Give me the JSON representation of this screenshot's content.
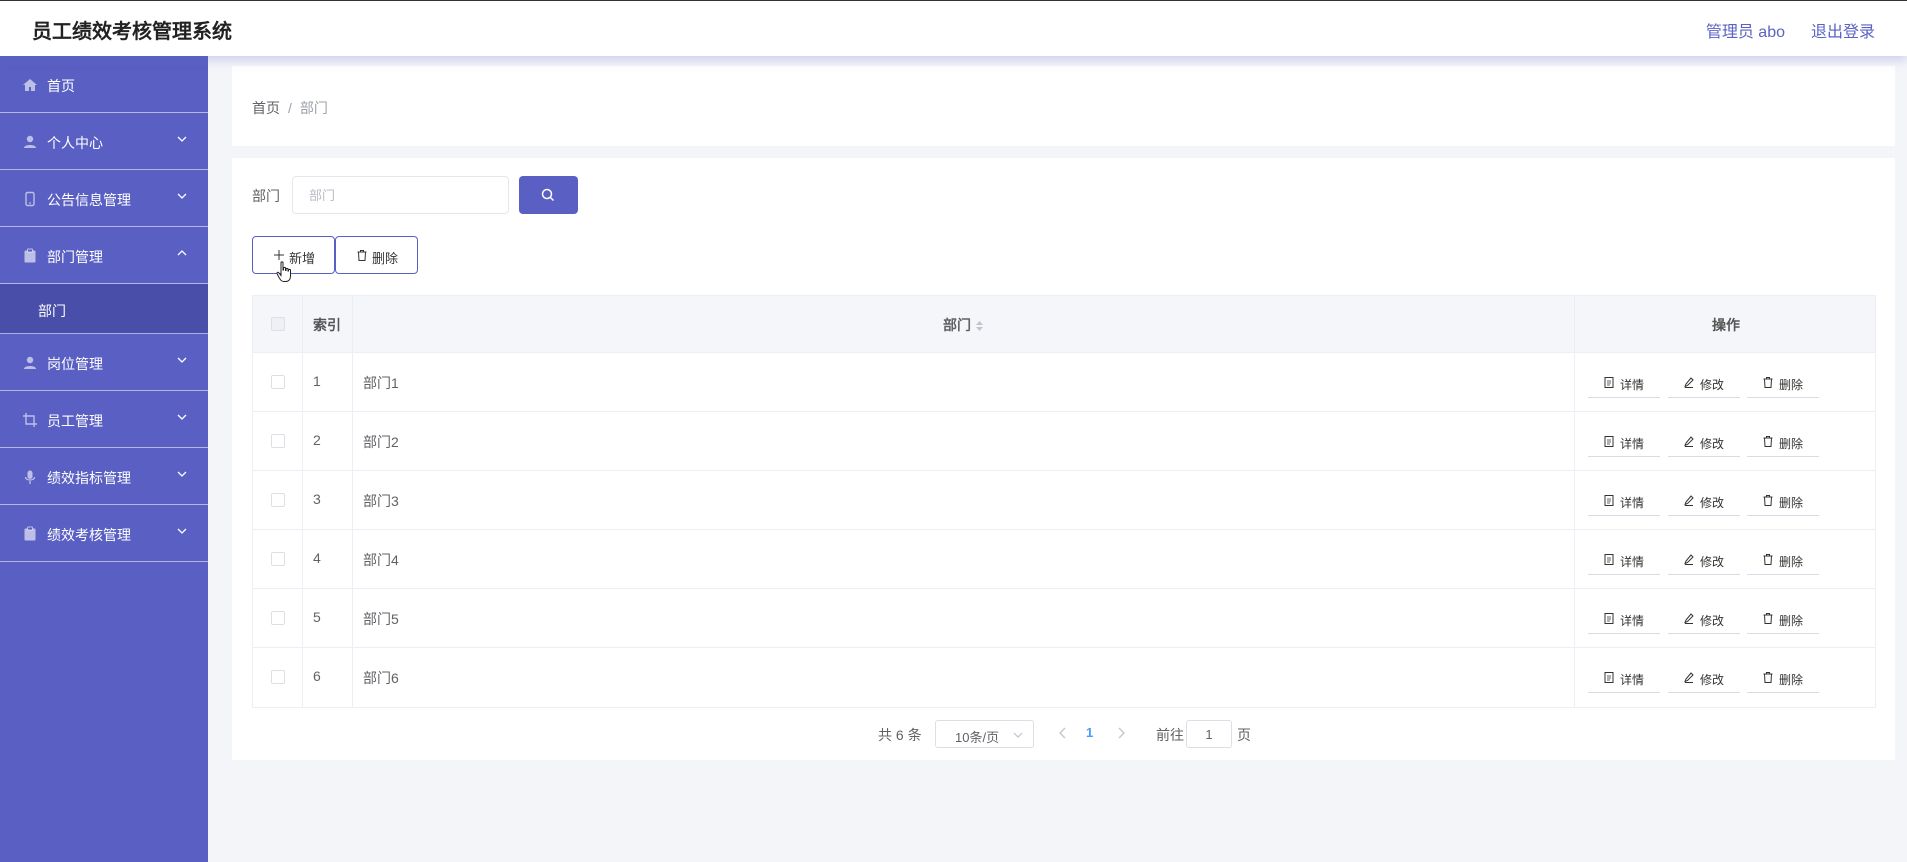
{
  "header": {
    "title": "员工绩效考核管理系统",
    "user": "管理员 abo",
    "logout": "退出登录"
  },
  "sidebar": {
    "items": [
      {
        "label": "首页",
        "icon": "home-icon"
      },
      {
        "label": "个人中心",
        "icon": "user-icon"
      },
      {
        "label": "公告信息管理",
        "icon": "phone-icon"
      },
      {
        "label": "部门管理",
        "icon": "clipboard-icon",
        "expanded": true
      },
      {
        "label": "岗位管理",
        "icon": "user-icon"
      },
      {
        "label": "员工管理",
        "icon": "crop-icon"
      },
      {
        "label": "绩效指标管理",
        "icon": "mic-icon"
      },
      {
        "label": "绩效考核管理",
        "icon": "clipboard-icon"
      }
    ],
    "sub_item": "部门"
  },
  "breadcrumb": {
    "home": "首页",
    "separator": "/",
    "current": "部门"
  },
  "search": {
    "label": "部门",
    "placeholder": "部门"
  },
  "toolbar": {
    "add_label": "新增",
    "delete_label": "删除"
  },
  "table": {
    "headers": {
      "index": "索引",
      "name": "部门",
      "ops": "操作"
    },
    "rows": [
      {
        "index": "1",
        "name": "部门1"
      },
      {
        "index": "2",
        "name": "部门2"
      },
      {
        "index": "3",
        "name": "部门3"
      },
      {
        "index": "4",
        "name": "部门4"
      },
      {
        "index": "5",
        "name": "部门5"
      },
      {
        "index": "6",
        "name": "部门6"
      }
    ],
    "ops": {
      "detail": "详情",
      "edit": "修改",
      "delete": "删除"
    }
  },
  "pagination": {
    "total": "共 6 条",
    "page_size": "10条/页",
    "current_page": "1",
    "goto_label": "前往",
    "goto_value": "1",
    "unit": "页"
  },
  "colors": {
    "accent": "#5a60c3",
    "page_bg": "#f4f5f9",
    "active_page": "#409eff"
  }
}
